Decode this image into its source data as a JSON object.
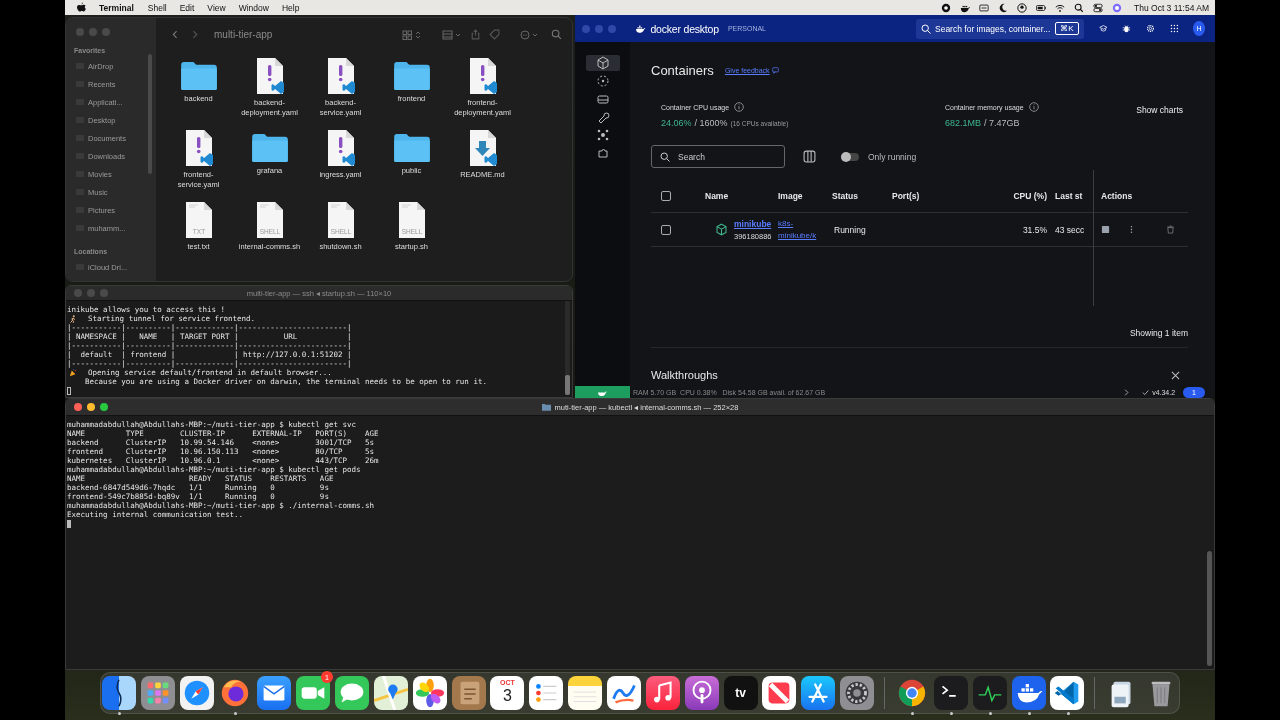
{
  "menu_bar": {
    "app_name": "Terminal",
    "items": [
      "Shell",
      "Edit",
      "View",
      "Window",
      "Help"
    ],
    "clock": "Thu Oct 3  11:54 AM"
  },
  "finder": {
    "title": "multi-tier-app",
    "sidebar": [
      {
        "heading": "Favorites",
        "items": [
          "AirDrop",
          "Recents",
          "Applicati...",
          "Desktop",
          "Documents",
          "Downloads",
          "Movies",
          "Music",
          "Pictures",
          "muhamm..."
        ]
      },
      {
        "heading": "Locations",
        "items": [
          "iCloud Dri..."
        ]
      }
    ],
    "files": [
      {
        "name": "backend",
        "kind": "folder"
      },
      {
        "name": "backend-deployment.yaml",
        "kind": "yaml"
      },
      {
        "name": "backend-service.yaml",
        "kind": "yaml"
      },
      {
        "name": "frontend",
        "kind": "folder"
      },
      {
        "name": "frontend-deployment.yaml",
        "kind": "yaml"
      },
      {
        "name": "frontend-service.yaml",
        "kind": "yaml"
      },
      {
        "name": "grafana",
        "kind": "folder"
      },
      {
        "name": "ingress.yaml",
        "kind": "yaml"
      },
      {
        "name": "public",
        "kind": "folder"
      },
      {
        "name": "README.md",
        "kind": "markdown"
      },
      {
        "name": "test.txt",
        "kind": "text",
        "badge": "TXT"
      },
      {
        "name": "internal-comms.sh",
        "kind": "text",
        "badge": "SHELL"
      },
      {
        "name": "shutdown.sh",
        "kind": "text",
        "badge": "SHELL"
      },
      {
        "name": "startup.sh",
        "kind": "text",
        "badge": "SHELL"
      }
    ]
  },
  "docker": {
    "brand": "docker desktop",
    "plan": "PERSONAL",
    "search": {
      "placeholder": "Search for images, container...",
      "shortcut": "⌘K"
    },
    "avatar": "H",
    "nav": [
      {
        "kind": "cube",
        "selected": true
      },
      {
        "kind": "dotted-circle",
        "selected": false
      },
      {
        "kind": "drive",
        "selected": false
      },
      {
        "kind": "wrench",
        "selected": false
      },
      {
        "kind": "nodes",
        "selected": false
      },
      {
        "kind": "puzzle",
        "selected": false
      }
    ],
    "title": "Containers",
    "feedback_link": "Give feedback",
    "cpu": {
      "label": "Container CPU usage",
      "value": "24.06%",
      "total": "/ 1600%",
      "note": "(16 CPUs available)"
    },
    "memory": {
      "label": "Container memory usage",
      "value": "682.1MB",
      "total": "/ 7.47GB"
    },
    "show_charts": "Show charts",
    "filter": {
      "placeholder": "Search",
      "only_running": {
        "label": "Only running",
        "on": false
      }
    },
    "table": {
      "columns": [
        "Name",
        "Image",
        "Status",
        "Port(s)",
        "CPU (%)",
        "Last st",
        "Actions"
      ],
      "all_checked": false,
      "rows": [
        {
          "name": "minikube",
          "id": "396180886",
          "image": "k8s-minikube/k",
          "status": "Running",
          "cpu": "31.5%",
          "last_started": "43 secc",
          "checked": false
        }
      ]
    },
    "footer": "Showing 1 item",
    "walkthroughs": "Walkthroughs",
    "status_bar": {
      "stats": "RAM 5.70 GB  CPU 0.38%   Disk 54.58 GB avail. of 62.67 GB",
      "version": "v4.34.2",
      "notifications": "1"
    }
  },
  "terminal_top": {
    "title": "multi-tier-app — ssh ◂ startup.sh — 110×10",
    "lines": [
      {
        "kind": "plain",
        "text": "inikube allows you to access this !"
      },
      {
        "kind": "runner",
        "text": "Starting tunnel for service frontend."
      },
      {
        "kind": "plain",
        "text": "|-----------|----------|-------------|------------------------|"
      },
      {
        "kind": "plain",
        "text": "| NAMESPACE |   NAME   | TARGET PORT |          URL           |"
      },
      {
        "kind": "plain",
        "text": "|-----------|----------|-------------|------------------------|"
      },
      {
        "kind": "plain",
        "text": "|  default  | frontend |             | http://127.0.0.1:51202 |"
      },
      {
        "kind": "plain",
        "text": "|-----------|----------|-------------|------------------------|"
      },
      {
        "kind": "party",
        "text": "Opening service default/frontend in default browser..."
      },
      {
        "kind": "plain",
        "text": "    Because you are using a Docker driver on darwin, the terminal needs to be open to run it."
      }
    ]
  },
  "terminal_bottom": {
    "title": "muti-tier-app — kubectl ◂ internal-comms.sh — 252×28",
    "lines": [
      "muhammadabdullah@Abdullahs-MBP:~/muti-tier-app $ kubectl get svc",
      "NAME         TYPE        CLUSTER-IP      EXTERNAL-IP   PORT(S)    AGE",
      "backend      ClusterIP   10.99.54.146    <none>        3001/TCP   5s",
      "frontend     ClusterIP   10.96.150.113   <none>        80/TCP     5s",
      "kubernetes   ClusterIP   10.96.0.1       <none>        443/TCP    26m",
      "muhammadabdullah@Abdullahs-MBP:~/muti-tier-app $ kubectl get pods",
      "NAME                       READY   STATUS    RESTARTS   AGE",
      "backend-6847d549d6-7hqdc   1/1     Running   0          9s",
      "frontend-549c7b885d-bq89v  1/1     Running   0          9s",
      "muhammadabdullah@Abdullahs-MBP:~/muti-tier-app $ ./internal-comms.sh",
      "Executing internal communication test.."
    ]
  },
  "dock": {
    "apps": [
      {
        "kind": "finder",
        "running": true
      },
      {
        "kind": "launchpad",
        "running": false
      },
      {
        "kind": "safari",
        "running": false
      },
      {
        "kind": "firefox",
        "running": true
      },
      {
        "kind": "mail",
        "running": false
      },
      {
        "kind": "facetime",
        "running": false,
        "badge": "1"
      },
      {
        "kind": "messages",
        "running": false
      },
      {
        "kind": "maps",
        "running": false
      },
      {
        "kind": "photos",
        "running": false
      },
      {
        "kind": "contacts",
        "running": false
      },
      {
        "kind": "calendar",
        "running": false,
        "month": "OCT",
        "day": "3"
      },
      {
        "kind": "reminders",
        "running": false
      },
      {
        "kind": "notes",
        "running": false
      },
      {
        "kind": "freeform",
        "running": false
      },
      {
        "kind": "music",
        "running": false
      },
      {
        "kind": "podcasts",
        "running": false
      },
      {
        "kind": "tv",
        "running": false,
        "label": "tv"
      },
      {
        "kind": "news",
        "running": false
      },
      {
        "kind": "appstore",
        "running": false
      },
      {
        "kind": "settings",
        "running": false
      }
    ],
    "recents": [
      {
        "kind": "chrome",
        "running": true
      },
      {
        "kind": "terminal",
        "running": true
      },
      {
        "kind": "activity",
        "running": true
      },
      {
        "kind": "docker",
        "running": true
      },
      {
        "kind": "vscode",
        "running": true
      }
    ],
    "stacks": [
      {
        "kind": "stack",
        "running": false
      },
      {
        "kind": "trash",
        "running": false
      }
    ]
  }
}
